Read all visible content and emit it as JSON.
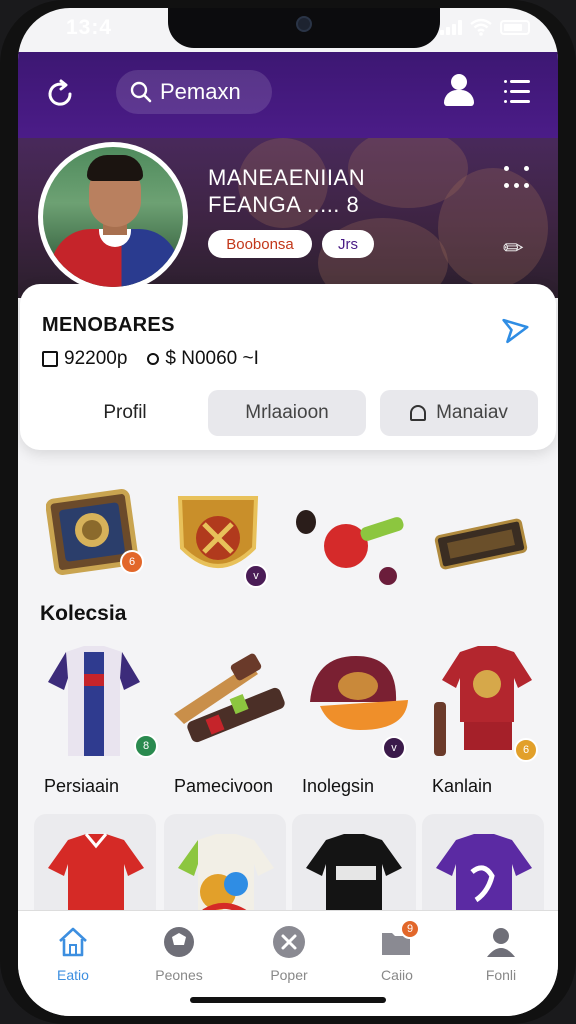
{
  "status": {
    "time": "13:4"
  },
  "topbar": {
    "search_text": "Pemaxn"
  },
  "profile": {
    "hero_line1": "MANEAENIIAN",
    "hero_line2": "FEANGA ..... 8",
    "chip_1": "Boobonsa",
    "chip_2": "Jrs",
    "name": "MENOBARES",
    "stat_1": "92200p",
    "stat_2": "$ N0060 ~I"
  },
  "tabs": {
    "profile": "Profil",
    "middle": "Mrlaaioon",
    "right": "Manaiav"
  },
  "collection": {
    "title": "Kolecsia",
    "labels": [
      "Persiaain",
      "Pamecivoon",
      "Inolegsin",
      "Kanlain"
    ]
  },
  "colors": {
    "brand_purple": "#4b1c88",
    "accent_blue": "#3d8fe0",
    "chip_orange": "#c2371a"
  },
  "nav": {
    "items": [
      {
        "label": "Eatio",
        "icon": "home-icon"
      },
      {
        "label": "Peones",
        "icon": "ball-icon"
      },
      {
        "label": "Poper",
        "icon": "close-circle-icon"
      },
      {
        "label": "Caiio",
        "icon": "folder-icon",
        "badge": "9"
      },
      {
        "label": "Fonli",
        "icon": "person-icon"
      }
    ]
  }
}
